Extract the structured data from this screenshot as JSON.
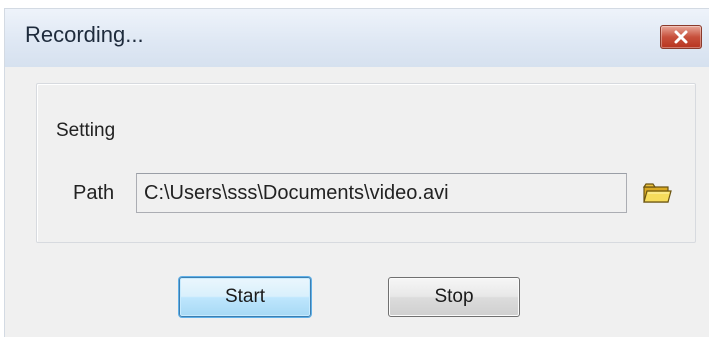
{
  "window": {
    "title": "Recording...",
    "close_icon": "close-icon"
  },
  "setting": {
    "group_label": "Setting",
    "path_label": "Path",
    "path_value": "C:\\Users\\sss\\Documents\\video.avi",
    "browse_icon": "folder-icon"
  },
  "buttons": {
    "start_label": "Start",
    "stop_label": "Stop"
  },
  "colors": {
    "close_button": "#c7503c",
    "default_button_border": "#3c7fb1",
    "folder_icon": "#f2d24a"
  }
}
